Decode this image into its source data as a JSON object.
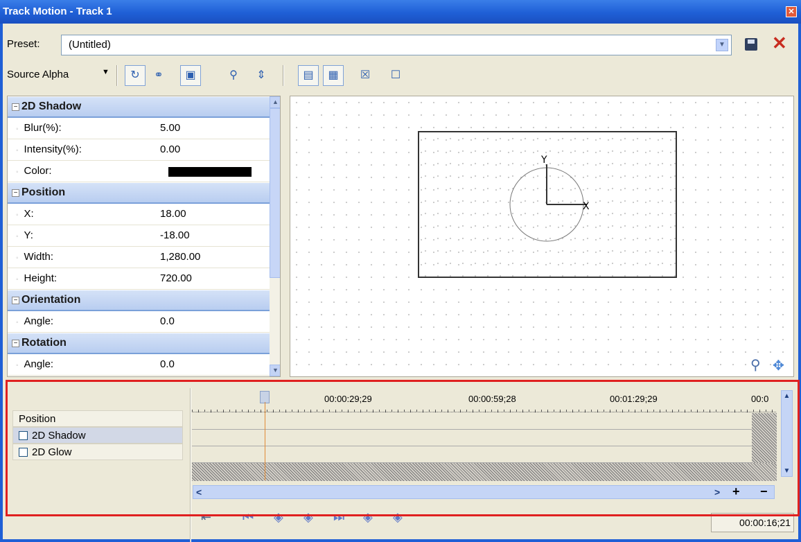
{
  "window": {
    "title": "Track Motion - Track 1",
    "close_icon": "close-icon"
  },
  "preset": {
    "label": "Preset:",
    "value": "(Untitled)"
  },
  "toolbar": {
    "source_alpha_label": "Source Alpha"
  },
  "properties": {
    "sections": [
      {
        "title": "2D Shadow",
        "rows": [
          {
            "key": "Blur(%):",
            "value": "5.00"
          },
          {
            "key": "Intensity(%):",
            "value": "0.00"
          },
          {
            "key": "Color:",
            "value": ""
          }
        ]
      },
      {
        "title": "Position",
        "rows": [
          {
            "key": "X:",
            "value": "18.00"
          },
          {
            "key": "Y:",
            "value": "-18.00"
          },
          {
            "key": "Width:",
            "value": "1,280.00"
          },
          {
            "key": "Height:",
            "value": "720.00"
          }
        ]
      },
      {
        "title": "Orientation",
        "rows": [
          {
            "key": "Angle:",
            "value": "0.0"
          }
        ]
      },
      {
        "title": "Rotation",
        "rows": [
          {
            "key": "Angle:",
            "value": "0.0"
          }
        ]
      }
    ],
    "shadow_color": "#000000"
  },
  "canvas": {
    "x_axis_label": "X",
    "y_axis_label": "Y"
  },
  "tracks": {
    "items": [
      {
        "label": "Position",
        "has_checkbox": false
      },
      {
        "label": "2D Shadow",
        "has_checkbox": true,
        "selected": true
      },
      {
        "label": "2D Glow",
        "has_checkbox": true
      }
    ]
  },
  "timeline": {
    "ruler_labels": [
      "00:00:29;29",
      "00:00:59;28",
      "00:01:29;29",
      "00:0"
    ],
    "current_time": "00:00:16;21"
  }
}
